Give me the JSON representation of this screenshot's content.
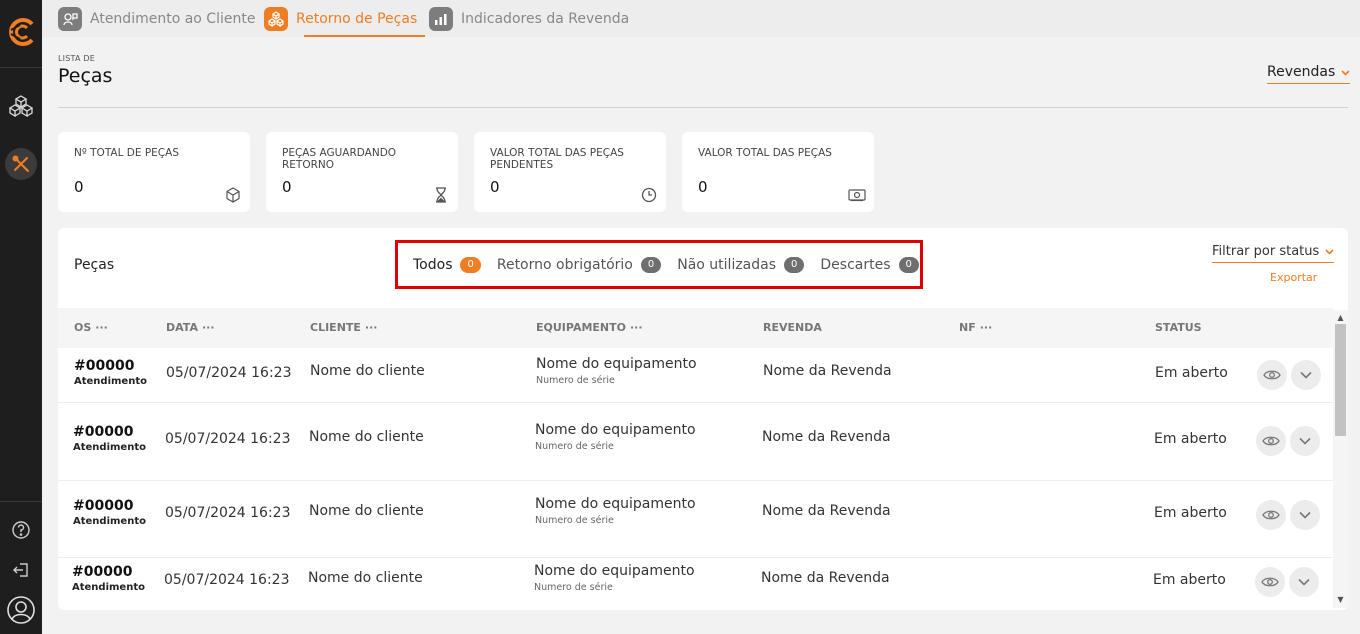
{
  "sidebar": {
    "logo_label": "C",
    "items": [
      {
        "icon": "cubes-icon",
        "active": false
      },
      {
        "icon": "tools-icon",
        "active": true
      }
    ],
    "bottom": [
      {
        "icon": "help-icon"
      },
      {
        "icon": "logout-icon"
      },
      {
        "icon": "user-avatar-icon"
      }
    ]
  },
  "topnav": {
    "tabs": [
      {
        "label": "Atendimento ao Cliente",
        "icon": "support-icon",
        "active": false
      },
      {
        "label": "Retorno de Peças",
        "icon": "parts-icon",
        "active": true
      },
      {
        "label": "Indicadores da Revenda",
        "icon": "bar-chart-icon",
        "active": false
      }
    ]
  },
  "header": {
    "subtitle": "LISTA DE",
    "title": "Peças",
    "revendas_label": "Revendas"
  },
  "cards": [
    {
      "label": "Nº TOTAL DE PEÇAS",
      "value": "0",
      "icon": "box-icon"
    },
    {
      "label": "PEÇAS AGUARDANDO RETORNO",
      "value": "0",
      "icon": "hourglass-icon"
    },
    {
      "label": "VALOR TOTAL DAS PEÇAS PENDENTES",
      "value": "0",
      "icon": "clock-icon"
    },
    {
      "label": "VALOR TOTAL DAS PEÇAS",
      "value": "0",
      "icon": "money-icon"
    }
  ],
  "table": {
    "title": "Peças",
    "filters": [
      {
        "label": "Todos",
        "count": "0",
        "active": true
      },
      {
        "label": "Retorno obrigatório",
        "count": "0",
        "active": false
      },
      {
        "label": "Não utilizadas",
        "count": "0",
        "active": false
      },
      {
        "label": "Descartes",
        "count": "0",
        "active": false
      }
    ],
    "status_filter_label": "Filtrar por status",
    "export_label": "Exportar",
    "columns": [
      {
        "label": "OS",
        "dots": "···"
      },
      {
        "label": "DATA",
        "dots": "···"
      },
      {
        "label": "CLIENTE",
        "dots": "···"
      },
      {
        "label": "EQUIPAMENTO",
        "dots": "···"
      },
      {
        "label": "REVENDA",
        "dots": ""
      },
      {
        "label": "NF",
        "dots": "···"
      },
      {
        "label": "STATUS",
        "dots": ""
      }
    ],
    "rows": [
      {
        "os": "#00000",
        "os_type": "Atendimento",
        "date": "05/07/2024 16:23",
        "client": "Nome do cliente",
        "equipment": "Nome do equipamento",
        "serial": "Numero de série",
        "dealer": "Nome da Revenda",
        "nf": "",
        "status": "Em aberto"
      },
      {
        "os": "#00000",
        "os_type": "Atendimento",
        "date": "05/07/2024 16:23",
        "client": "Nome do cliente",
        "equipment": "Nome do equipamento",
        "serial": "Numero de série",
        "dealer": "Nome da Revenda",
        "nf": "",
        "status": "Em aberto"
      },
      {
        "os": "#00000",
        "os_type": "Atendimento",
        "date": "05/07/2024 16:23",
        "client": "Nome do cliente",
        "equipment": "Nome do equipamento",
        "serial": "Numero de série",
        "dealer": "Nome da Revenda",
        "nf": "",
        "status": "Em aberto"
      },
      {
        "os": "#00000",
        "os_type": "Atendimento",
        "date": "05/07/2024 16:23",
        "client": "Nome do cliente",
        "equipment": "Nome do equipamento",
        "serial": "Numero de série",
        "dealer": "Nome da Revenda",
        "nf": "",
        "status": "Em aberto"
      }
    ]
  },
  "colors": {
    "accent": "#ef7d22",
    "sidebar_bg": "#1e1e1e",
    "highlight_border": "#e00000"
  }
}
